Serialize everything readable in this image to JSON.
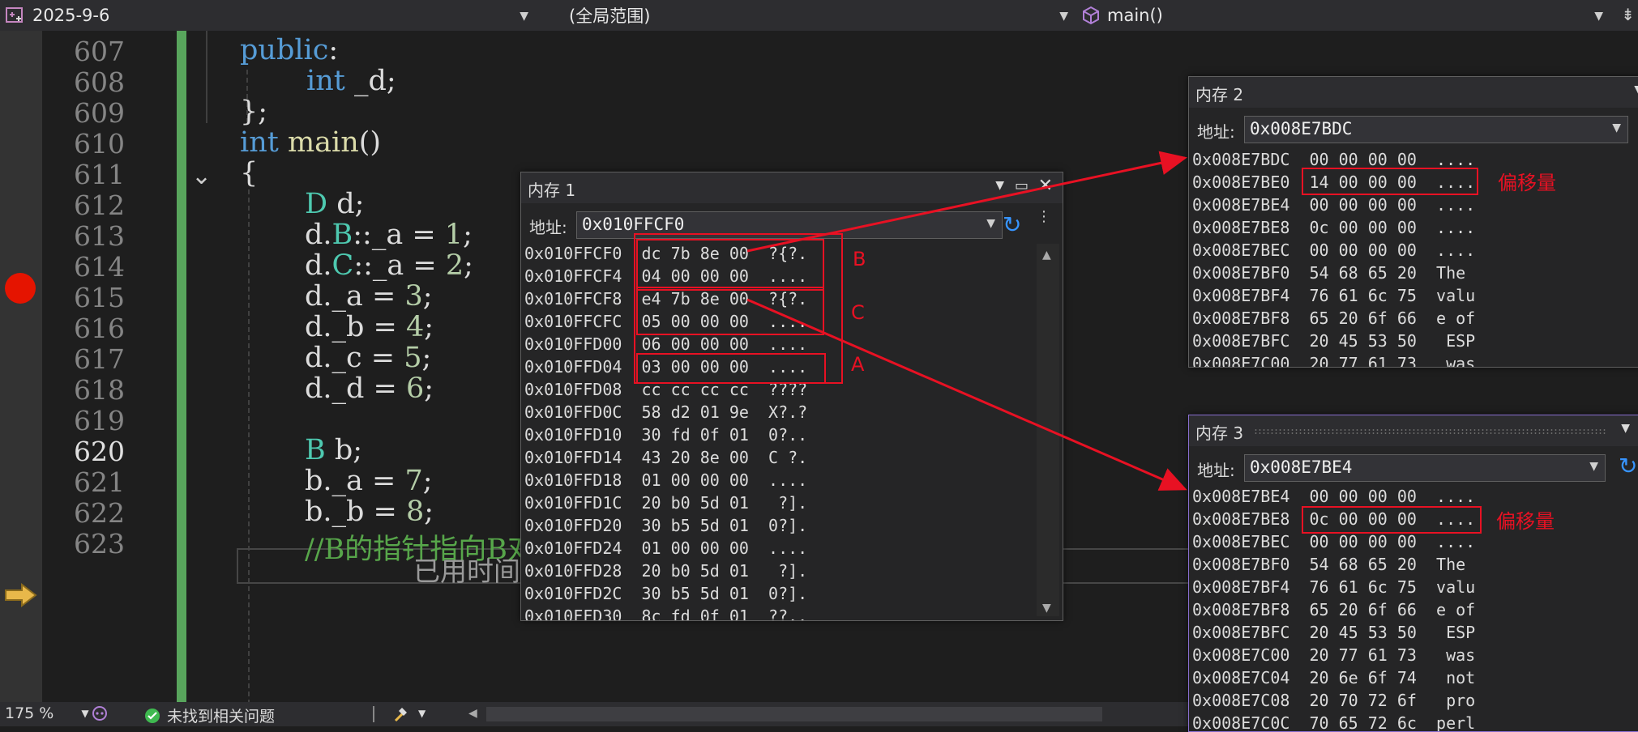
{
  "navbar": {
    "project": "2025-9-6",
    "scope": "(全局范围)",
    "member": "main()"
  },
  "editor": {
    "line_numbers": [
      "607",
      "608",
      "609",
      "610",
      "611",
      "612",
      "613",
      "614",
      "615",
      "616",
      "617",
      "618",
      "619",
      "620",
      "621",
      "622",
      "623"
    ],
    "current_line": "620",
    "code": {
      "l607_kw": "public",
      "l607_rest": ":",
      "l608_kw": "int",
      "l608_rest": " _d;",
      "l609": "};",
      "l610_kw": "int",
      "l610_fn": "main",
      "l610_rest": "()",
      "l611": "{",
      "l612_ty": "D",
      "l612_rest": " d;",
      "l613_a": "d.",
      "l613_ty": "B",
      "l613_b": "::_a = ",
      "l613_num": "1",
      "l613_c": ";",
      "l614_a": "d.",
      "l614_ty": "C",
      "l614_b": "::_a = ",
      "l614_num": "2",
      "l614_c": ";",
      "l615_a": "d.",
      "l615_b": "_a = ",
      "l615_num": "3",
      "l615_c": ";",
      "l616_a": "d.",
      "l616_b": "_b = ",
      "l616_num": "4",
      "l616_c": ";",
      "l617_a": "d.",
      "l617_b": "_c = ",
      "l617_num": "5",
      "l617_c": ";",
      "l618_a": "d.",
      "l618_b": "_d = ",
      "l618_num": "6",
      "l618_c": ";",
      "l620_ty": "B",
      "l620_rest": " b;",
      "l621_a": "b.",
      "l621_b": "_a = ",
      "l621_num": "7",
      "l621_c": ";",
      "l622_a": "b.",
      "l622_b": "_b = ",
      "l622_num": "8",
      "l622_c": ";",
      "l623_cm": "//B的指针指向B对象"
    },
    "elapsed_hint": "已用时间"
  },
  "status": {
    "zoom": "175 %",
    "issues": "未找到相关问题"
  },
  "mem1": {
    "title": "内存 1",
    "addr_label": "地址:",
    "address": "0x010FFCF0",
    "rows": [
      "0x010FFCF0  dc 7b 8e 00  ?{?.",
      "0x010FFCF4  04 00 00 00  ....",
      "0x010FFCF8  e4 7b 8e 00  ?{?.",
      "0x010FFCFC  05 00 00 00  ....",
      "0x010FFD00  06 00 00 00  ....",
      "0x010FFD04  03 00 00 00  ....",
      "0x010FFD08  cc cc cc cc  ????",
      "0x010FFD0C  58 d2 01 9e  X?.?",
      "0x010FFD10  30 fd 0f 01  0?..",
      "0x010FFD14  43 20 8e 00  C ?.",
      "0x010FFD18  01 00 00 00  ....",
      "0x010FFD1C  20 b0 5d 01   ?].",
      "0x010FFD20  30 b5 5d 01  0?].",
      "0x010FFD24  01 00 00 00  ....",
      "0x010FFD28  20 b0 5d 01   ?].",
      "0x010FFD2C  30 b5 5d 01  0?].",
      "0x010FFD30  8c fd 0f 01  ??.."
    ],
    "labels": {
      "b": "B",
      "c": "C",
      "a": "A"
    }
  },
  "mem2": {
    "title": "内存 2",
    "addr_label": "地址:",
    "address": "0x008E7BDC",
    "rows": [
      "0x008E7BDC  00 00 00 00  ....",
      "0x008E7BE0  14 00 00 00  ....",
      "0x008E7BE4  00 00 00 00  ....",
      "0x008E7BE8  0c 00 00 00  ....",
      "0x008E7BEC  00 00 00 00  ....",
      "0x008E7BF0  54 68 65 20  The ",
      "0x008E7BF4  76 61 6c 75  valu",
      "0x008E7BF8  65 20 6f 66  e of",
      "0x008E7BFC  20 45 53 50   ESP",
      "0x008E7C00  20 77 61 73   was"
    ],
    "offset_label": "偏移量"
  },
  "mem3": {
    "title": "内存 3",
    "addr_label": "地址:",
    "address": "0x008E7BE4",
    "rows": [
      "0x008E7BE4  00 00 00 00  ....",
      "0x008E7BE8  0c 00 00 00  ....",
      "0x008E7BEC  00 00 00 00  ....",
      "0x008E7BF0  54 68 65 20  The ",
      "0x008E7BF4  76 61 6c 75  valu",
      "0x008E7BF8  65 20 6f 66  e of",
      "0x008E7BFC  20 45 53 50   ESP",
      "0x008E7C00  20 77 61 73   was",
      "0x008E7C04  20 6e 6f 74   not",
      "0x008E7C08  20 70 72 6f   pro",
      "0x008E7C0C  70 65 72 6c  perl"
    ],
    "offset_label": "偏移量"
  },
  "colors": {
    "annotation_red": "#e81123",
    "breakpoint_red": "#e51400",
    "change_bar_green": "#58a55c",
    "exec_arrow_yellow": "#e8b84a"
  }
}
